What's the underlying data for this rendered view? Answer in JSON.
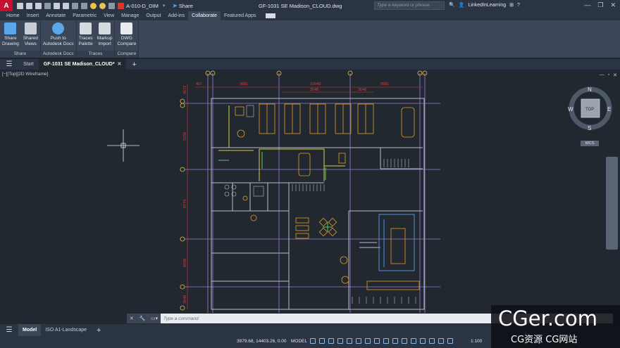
{
  "titlebar": {
    "app_logo": "A",
    "layer": "A-010-D_DIM",
    "share": "Share",
    "document_title": "GF-1031 SE Madison_CLOUD.dwg",
    "search_placeholder": "Type a keyword or phrase",
    "user": "LinkedInLearning",
    "layer_color": "#e0342d"
  },
  "ribbon": {
    "tabs": [
      "Home",
      "Insert",
      "Annotate",
      "Parametric",
      "View",
      "Manage",
      "Output",
      "Add-ins",
      "Collaborate",
      "Featured Apps"
    ],
    "active_tab": "Collaborate",
    "groups": [
      {
        "label": "Share",
        "buttons": [
          {
            "line1": "Share",
            "line2": "Drawing",
            "icon": "share-drawing-icon"
          },
          {
            "line1": "Shared",
            "line2": "Views",
            "icon": "shared-views-icon"
          }
        ]
      },
      {
        "label": "Autodesk Docs",
        "buttons": [
          {
            "line1": "Push to",
            "line2": "Autodesk Docs",
            "icon": "push-docs-icon"
          }
        ]
      },
      {
        "label": "Traces",
        "buttons": [
          {
            "line1": "Traces",
            "line2": "Palette",
            "icon": "traces-palette-icon"
          },
          {
            "line1": "Markup",
            "line2": "Import",
            "icon": "markup-import-icon"
          }
        ]
      },
      {
        "label": "Compare",
        "buttons": [
          {
            "line1": "DWG",
            "line2": "Compare",
            "icon": "dwg-compare-icon"
          }
        ]
      }
    ]
  },
  "filetabs": {
    "start": "Start",
    "active": "GF-1031 SE Madison_CLOUD*"
  },
  "viewport": {
    "label": "[−][Top][2D Wireframe]",
    "viewcube": {
      "n": "N",
      "s": "S",
      "e": "E",
      "w": "W",
      "top": "TOP"
    },
    "wcs": "WCS",
    "dims": {
      "top_left": "457",
      "top1": "9681",
      "top_mid": "10040",
      "top_mid2": "3048",
      "top_right_inner": "3048",
      "top_right": "9581",
      "left1": "4572",
      "left2": "9258",
      "left3": "9774",
      "left4": "6096",
      "left5": "3048"
    }
  },
  "cmdline": {
    "placeholder": "Type a command"
  },
  "statusbar": {
    "layout_tabs": [
      "Model",
      "ISO A1-Landscape"
    ],
    "active_layout": "Model",
    "coords": "3979.68, 14403.26, 0.00",
    "space": "MODEL",
    "scale": "1:100"
  },
  "watermark": {
    "big": "CGer.com",
    "small": "CG资源 CG网站"
  }
}
